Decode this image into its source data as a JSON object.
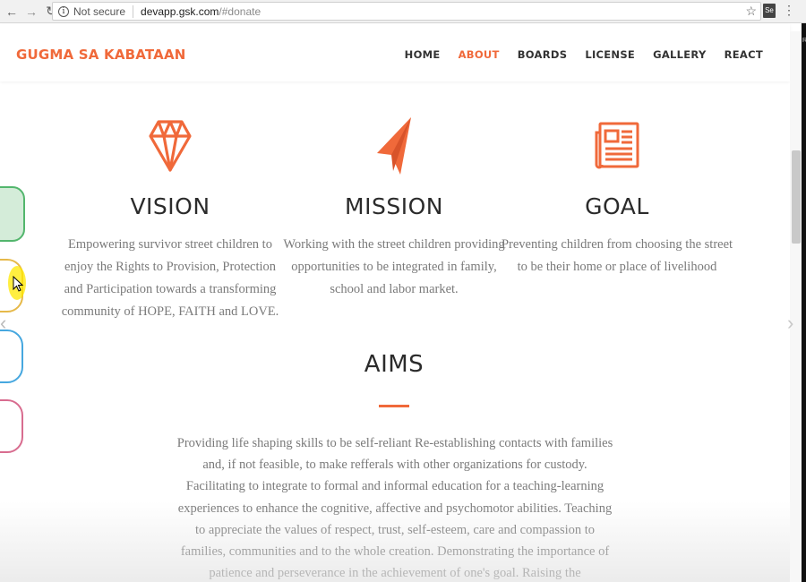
{
  "browser": {
    "security_label": "Not secure",
    "host": "devapp.gsk.com",
    "path": "/#donate",
    "ext_label": "Se",
    "edge_letter": "R"
  },
  "site": {
    "brand": "GUGMA SA KABATAAN",
    "menu": [
      "HOME",
      "ABOUT",
      "BOARDS",
      "LICENSE",
      "GALLERY",
      "REACT"
    ],
    "active_menu": "ABOUT"
  },
  "features": [
    {
      "icon": "diamond-icon",
      "title": "VISION",
      "text": "Empowering survivor street children to enjoy the Rights to Provision, Protection and Participation towards a transforming community of HOPE, FAITH and LOVE."
    },
    {
      "icon": "paper-plane-icon",
      "title": "MISSION",
      "text": "Working with the street children providing opportunities to be integrated in family, school and labor market."
    },
    {
      "icon": "newspaper-icon",
      "title": "GOAL",
      "text": "Preventing children from choosing the street to be their home or place of livelihood"
    }
  ],
  "aims": {
    "title": "AIMS",
    "text": "Providing life shaping skills to be self-reliant Re-establishing contacts with families and, if not feasible, to make refferals with other organizations for custody. Facilitating to integrate to formal and informal education for a teaching-learning experiences to enhance the cognitive, affective and psychomotor abilities. Teaching to appreciate the values of respect, trust, self-esteem, care and compassion to families, communities and to the whole creation. Demonstrating the importance of patience and perseverance in the achievement of one's goal. Raising the concsciousness of families and communities to"
  },
  "colors": {
    "accent": "#f0693a",
    "heading": "#2b2b2b",
    "body_text": "#7a7a7a"
  }
}
